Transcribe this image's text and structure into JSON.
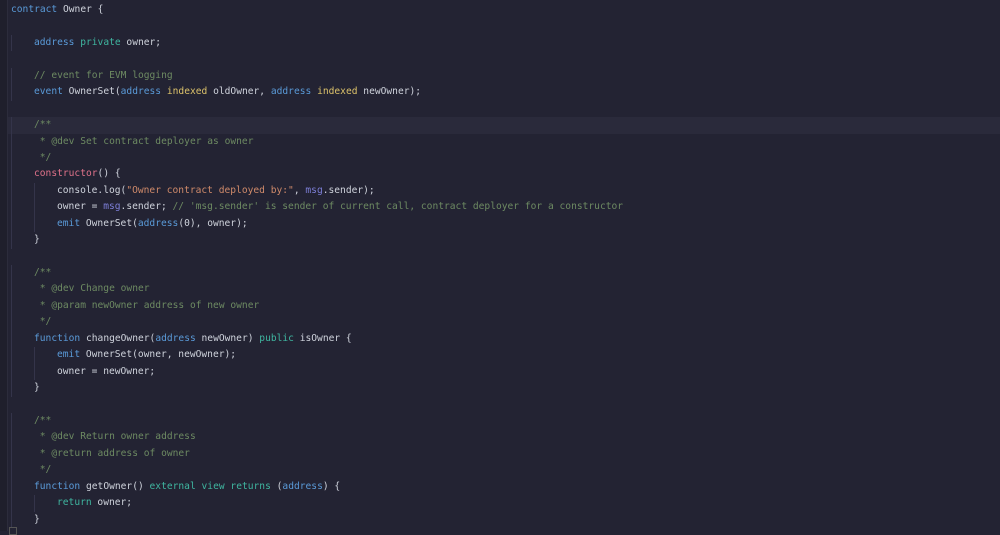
{
  "editor": {
    "lines": [
      {
        "indent": 0,
        "tokens": [
          [
            "kw",
            "contract"
          ],
          [
            "tx",
            " Owner {"
          ]
        ]
      },
      {
        "indent": 0,
        "tokens": []
      },
      {
        "indent": 1,
        "tokens": [
          [
            "kw",
            "address"
          ],
          [
            "tx",
            " "
          ],
          [
            "mod",
            "private"
          ],
          [
            "tx",
            " owner;"
          ]
        ]
      },
      {
        "indent": 0,
        "tokens": []
      },
      {
        "indent": 1,
        "tokens": [
          [
            "cm",
            "// event for EVM logging"
          ]
        ]
      },
      {
        "indent": 1,
        "tokens": [
          [
            "kw",
            "event"
          ],
          [
            "tx",
            " OwnerSet("
          ],
          [
            "kw",
            "address"
          ],
          [
            "tx",
            " "
          ],
          [
            "ix",
            "indexed"
          ],
          [
            "tx",
            " oldOwner, "
          ],
          [
            "kw",
            "address"
          ],
          [
            "tx",
            " "
          ],
          [
            "ix",
            "indexed"
          ],
          [
            "tx",
            " newOwner);"
          ]
        ]
      },
      {
        "indent": 0,
        "tokens": []
      },
      {
        "indent": 1,
        "current": true,
        "tokens": [
          [
            "cm",
            "/**"
          ]
        ]
      },
      {
        "indent": 1,
        "tokens": [
          [
            "cm",
            " * @dev Set contract deployer as owner"
          ]
        ]
      },
      {
        "indent": 1,
        "tokens": [
          [
            "cm",
            " */"
          ]
        ]
      },
      {
        "indent": 1,
        "tokens": [
          [
            "fn",
            "constructor"
          ],
          [
            "tx",
            "() {"
          ]
        ]
      },
      {
        "indent": 2,
        "tokens": [
          [
            "tx",
            "console.log("
          ],
          [
            "str",
            "\"Owner contract deployed by:\""
          ],
          [
            "tx",
            ", "
          ],
          [
            "msg",
            "msg"
          ],
          [
            "tx",
            ".sender);"
          ]
        ]
      },
      {
        "indent": 2,
        "tokens": [
          [
            "tx",
            "owner = "
          ],
          [
            "msg",
            "msg"
          ],
          [
            "tx",
            ".sender; "
          ],
          [
            "cm",
            "// 'msg.sender' is sender of current call, contract deployer for a constructor"
          ]
        ]
      },
      {
        "indent": 2,
        "tokens": [
          [
            "kw",
            "emit"
          ],
          [
            "tx",
            " OwnerSet("
          ],
          [
            "kw",
            "address"
          ],
          [
            "tx",
            "(0), owner);"
          ]
        ]
      },
      {
        "indent": 1,
        "tokens": [
          [
            "tx",
            "}"
          ]
        ]
      },
      {
        "indent": 0,
        "tokens": []
      },
      {
        "indent": 1,
        "tokens": [
          [
            "cm",
            "/**"
          ]
        ]
      },
      {
        "indent": 1,
        "tokens": [
          [
            "cm",
            " * @dev Change owner"
          ]
        ]
      },
      {
        "indent": 1,
        "tokens": [
          [
            "cm",
            " * @param newOwner address of new owner"
          ]
        ]
      },
      {
        "indent": 1,
        "tokens": [
          [
            "cm",
            " */"
          ]
        ]
      },
      {
        "indent": 1,
        "tokens": [
          [
            "kw",
            "function"
          ],
          [
            "tx",
            " changeOwner("
          ],
          [
            "kw",
            "address"
          ],
          [
            "tx",
            " newOwner) "
          ],
          [
            "mod",
            "public"
          ],
          [
            "tx",
            " isOwner {"
          ]
        ]
      },
      {
        "indent": 2,
        "tokens": [
          [
            "kw",
            "emit"
          ],
          [
            "tx",
            " OwnerSet(owner, newOwner);"
          ]
        ]
      },
      {
        "indent": 2,
        "tokens": [
          [
            "tx",
            "owner = newOwner;"
          ]
        ]
      },
      {
        "indent": 1,
        "tokens": [
          [
            "tx",
            "}"
          ]
        ]
      },
      {
        "indent": 0,
        "tokens": []
      },
      {
        "indent": 1,
        "tokens": [
          [
            "cm",
            "/**"
          ]
        ]
      },
      {
        "indent": 1,
        "tokens": [
          [
            "cm",
            " * @dev Return owner address"
          ]
        ]
      },
      {
        "indent": 1,
        "tokens": [
          [
            "cm",
            " * @return address of owner"
          ]
        ]
      },
      {
        "indent": 1,
        "tokens": [
          [
            "cm",
            " */"
          ]
        ]
      },
      {
        "indent": 1,
        "tokens": [
          [
            "kw",
            "function"
          ],
          [
            "tx",
            " getOwner() "
          ],
          [
            "mod",
            "external"
          ],
          [
            "tx",
            " "
          ],
          [
            "mod",
            "view"
          ],
          [
            "tx",
            " "
          ],
          [
            "mod",
            "returns"
          ],
          [
            "tx",
            " ("
          ],
          [
            "kw",
            "address"
          ],
          [
            "tx",
            ") {"
          ]
        ]
      },
      {
        "indent": 2,
        "tokens": [
          [
            "ret",
            "return"
          ],
          [
            "tx",
            " owner;"
          ]
        ]
      },
      {
        "indent": 1,
        "tokens": [
          [
            "tx",
            "}"
          ]
        ]
      }
    ]
  }
}
